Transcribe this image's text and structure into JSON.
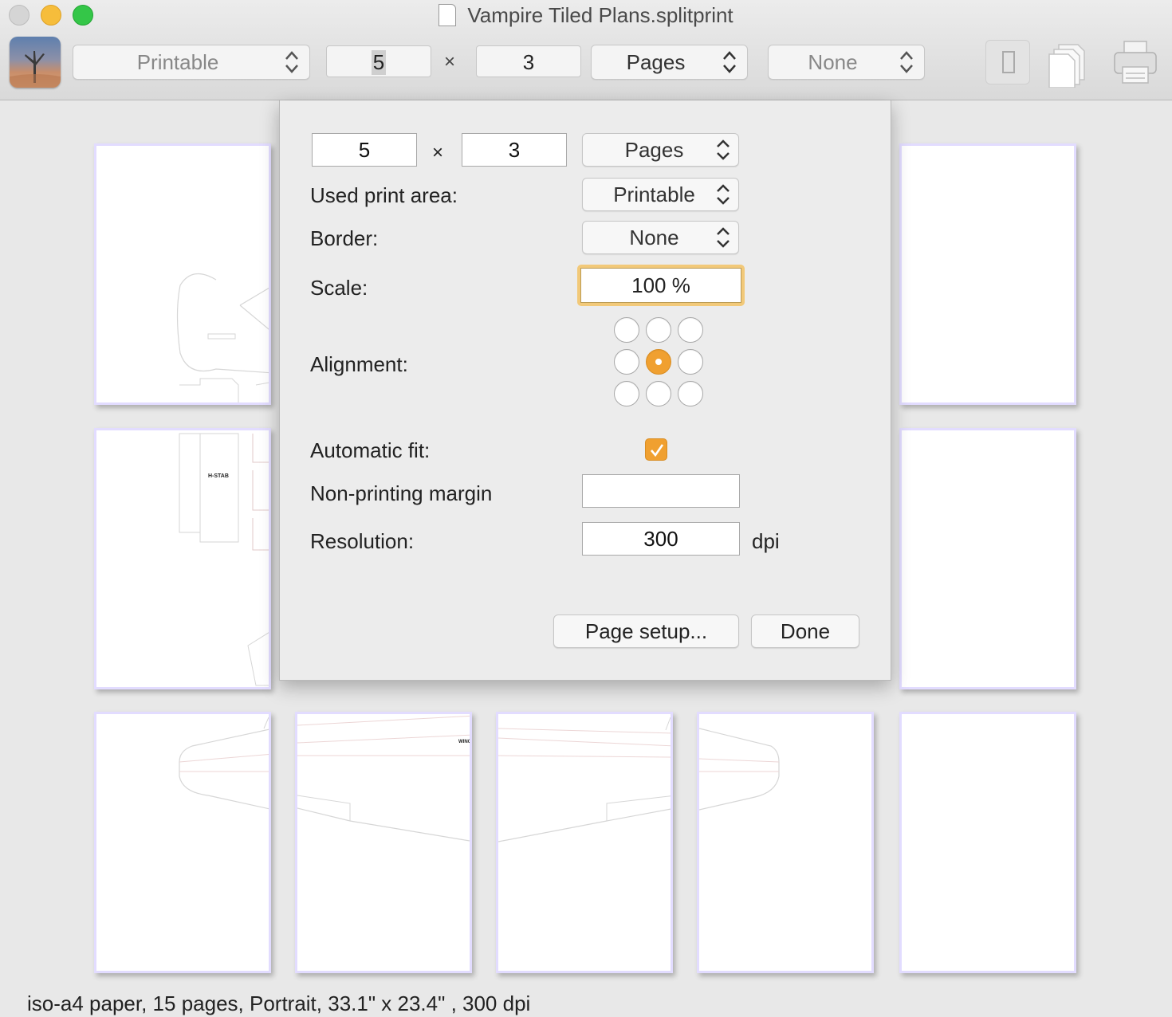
{
  "window": {
    "title": "Vampire Tiled Plans.splitprint"
  },
  "toolbar": {
    "print_area": "Printable",
    "columns": "5",
    "times": "×",
    "rows": "3",
    "unit": "Pages",
    "border": "None"
  },
  "dialog": {
    "columns": "5",
    "times": "×",
    "rows": "3",
    "unit": "Pages",
    "used_print_area_label": "Used print area:",
    "used_print_area": "Printable",
    "border_label": "Border:",
    "border": "None",
    "scale_label": "Scale:",
    "scale": "100 %",
    "alignment_label": "Alignment:",
    "alignment_selected": "center",
    "automatic_fit_label": "Automatic fit:",
    "automatic_fit": true,
    "non_printing_margin_label": "Non-printing margin",
    "non_printing_margin": "",
    "resolution_label": "Resolution:",
    "resolution": "300",
    "resolution_unit": "dpi",
    "page_setup_button": "Page setup...",
    "done_button": "Done"
  },
  "pages": {
    "hstab_label": "H-STAB",
    "wing_label": "WING"
  },
  "status_bar": {
    "text": "iso-a4 paper, 15 pages, Portrait, 33.1\" x 23.4\" , 300 dpi"
  },
  "colors": {
    "accent": "#f0a030",
    "traffic_close": "#d5d5d5",
    "traffic_minimize": "#f6bd3b",
    "traffic_maximize": "#34c648"
  }
}
